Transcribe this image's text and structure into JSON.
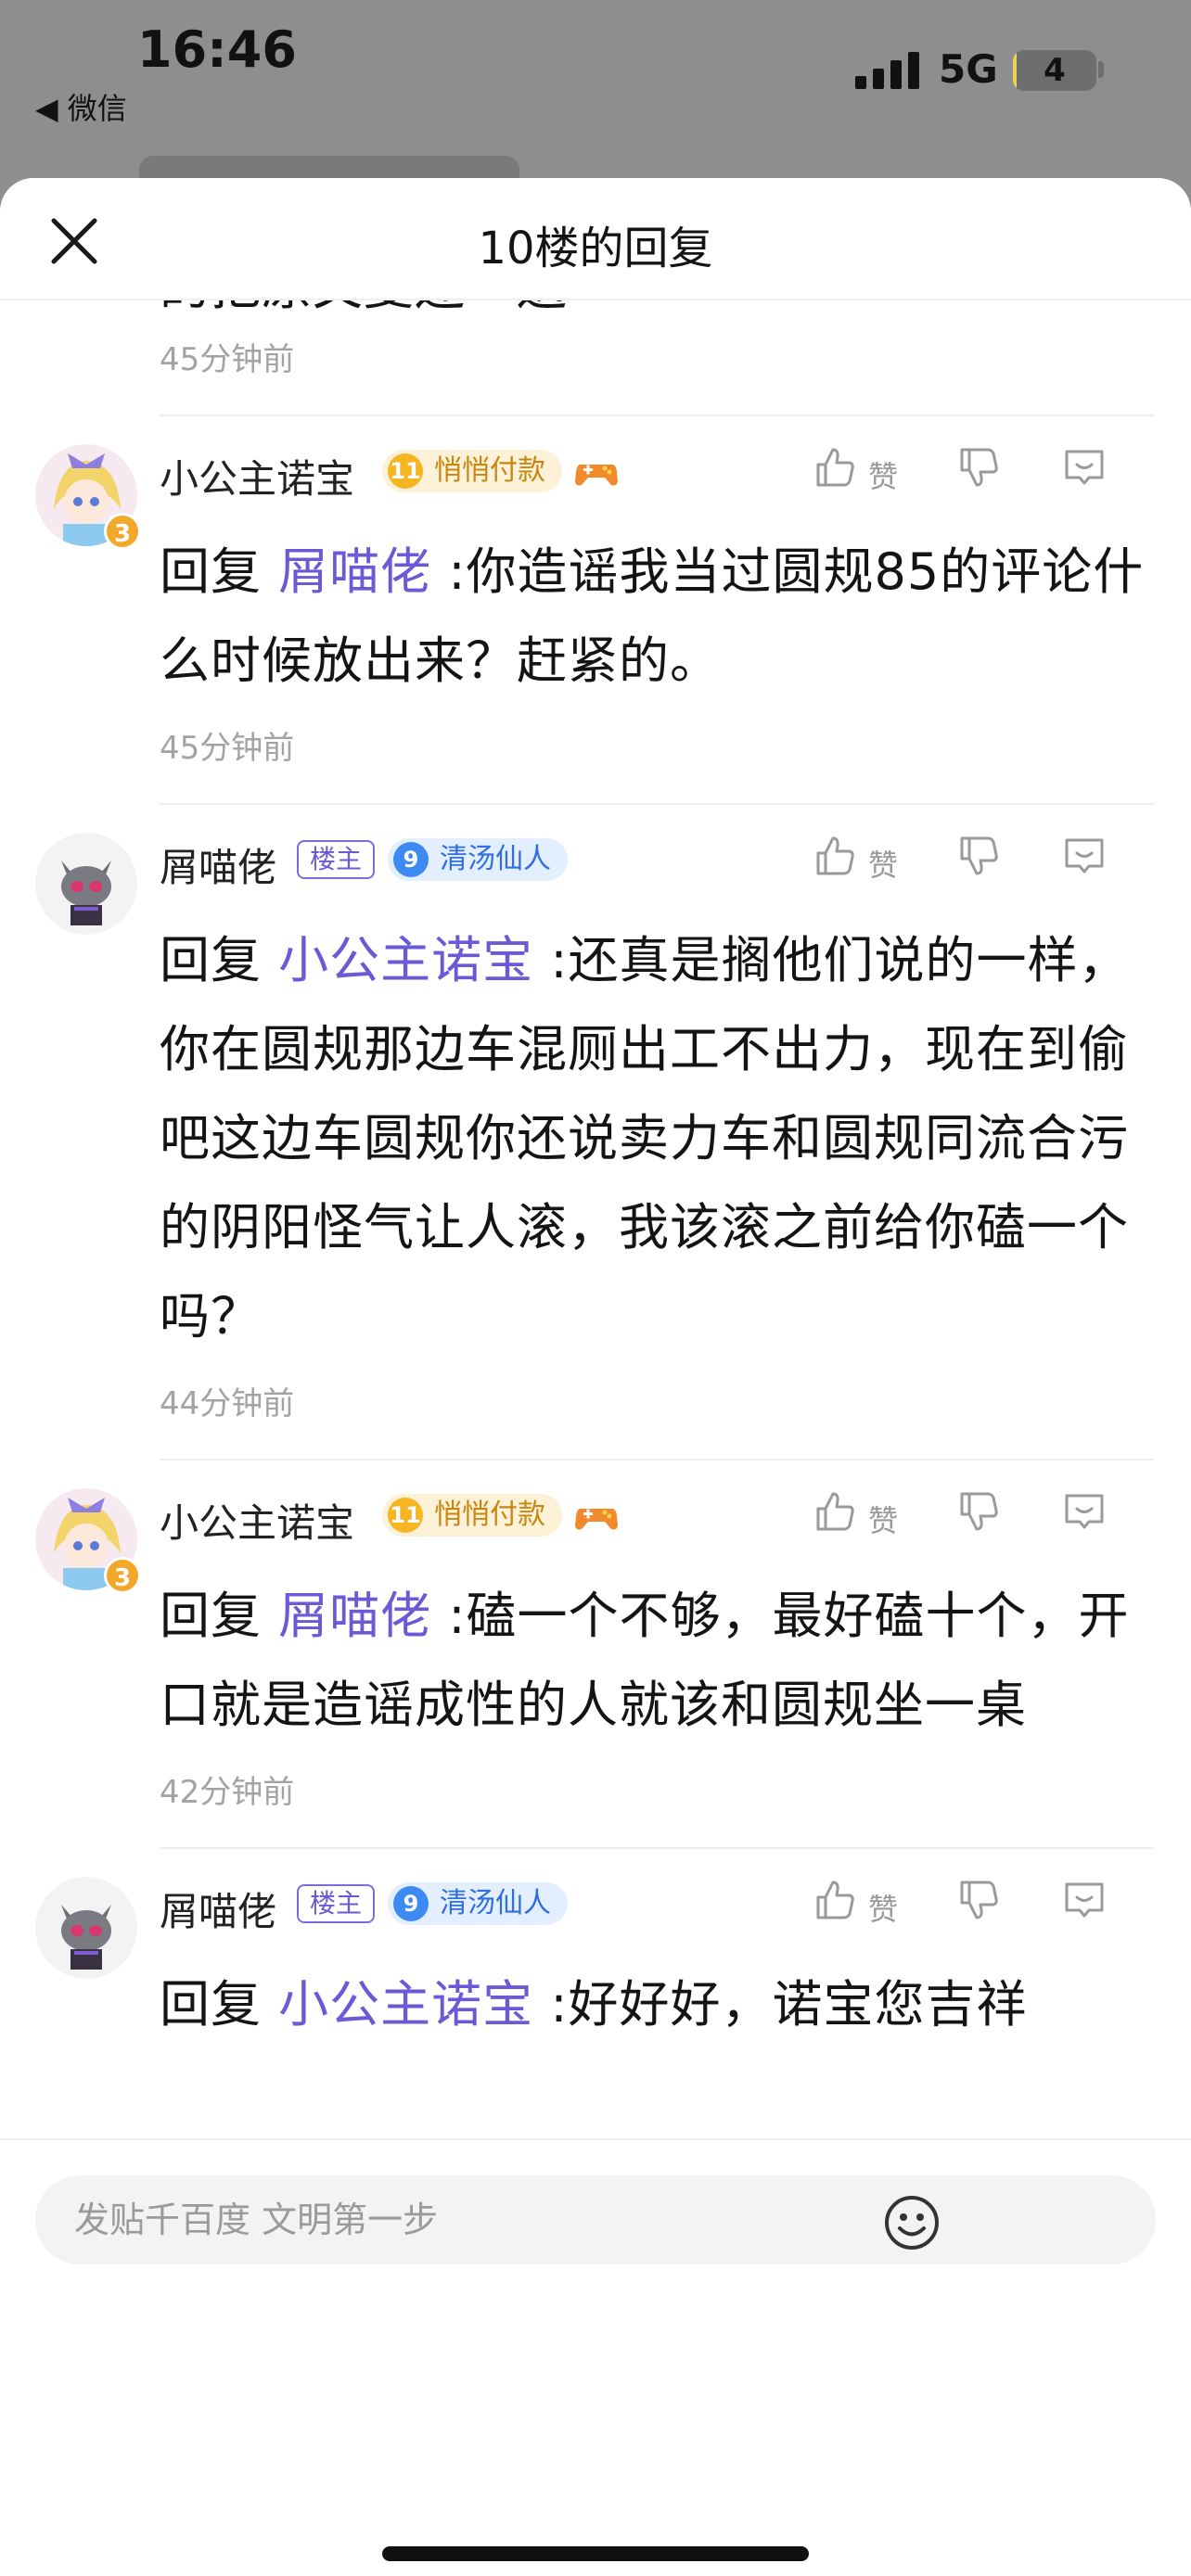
{
  "status_bar": {
    "time": "16:46",
    "back_label": "◀ 微信",
    "network": "5G",
    "battery_percent": 4
  },
  "sheet": {
    "title": "10楼的回复",
    "close_icon": "close-icon"
  },
  "fragment": {
    "text": "的把原文复还一遍",
    "time": "45分钟前"
  },
  "replies": [
    {
      "username": "小公主诺宝",
      "avatar": "anime-girl-avatar",
      "avatar_level": "3",
      "is_host": false,
      "level_num": "11",
      "level_title": "悄悄付款",
      "level_color": "#f5b621",
      "extra_badge": "gamepad-icon",
      "like_label": "赞",
      "prefix": "回复 ",
      "mention": "屑喵佬",
      "text": " :你造谣我当过圆规85的评论什么时候放出来？赶紧的。",
      "time": "45分钟前"
    },
    {
      "username": "屑喵佬",
      "avatar": "cat-avatar",
      "is_host": true,
      "host_label": "楼主",
      "level_num": "9",
      "level_title": "清汤仙人",
      "level_color": "#3d8bf2",
      "like_label": "赞",
      "prefix": "回复 ",
      "mention": "小公主诺宝",
      "text": " :还真是搁他们说的一样，你在圆规那边车混厕出工不出力，现在到偷吧这边车圆规你还说卖力车和圆规同流合污的阴阳怪气让人滚，我该滚之前给你磕一个吗？",
      "time": "44分钟前"
    },
    {
      "username": "小公主诺宝",
      "avatar": "anime-girl-avatar",
      "avatar_level": "3",
      "is_host": false,
      "level_num": "11",
      "level_title": "悄悄付款",
      "level_color": "#f5b621",
      "extra_badge": "gamepad-icon",
      "like_label": "赞",
      "prefix": "回复 ",
      "mention": "屑喵佬",
      "text": " :磕一个不够，最好磕十个，开口就是造谣成性的人就该和圆规坐一桌",
      "time": "42分钟前"
    },
    {
      "username": "屑喵佬",
      "avatar": "cat-avatar",
      "is_host": true,
      "host_label": "楼主",
      "level_num": "9",
      "level_title": "清汤仙人",
      "level_color": "#3d8bf2",
      "like_label": "赞",
      "prefix": "回复 ",
      "mention": "小公主诺宝",
      "text": " :好好好，诺宝您吉祥",
      "time": ""
    }
  ],
  "composer": {
    "placeholder": "发贴千百度 文明第一步",
    "emoji_icon": "smiley-icon"
  }
}
